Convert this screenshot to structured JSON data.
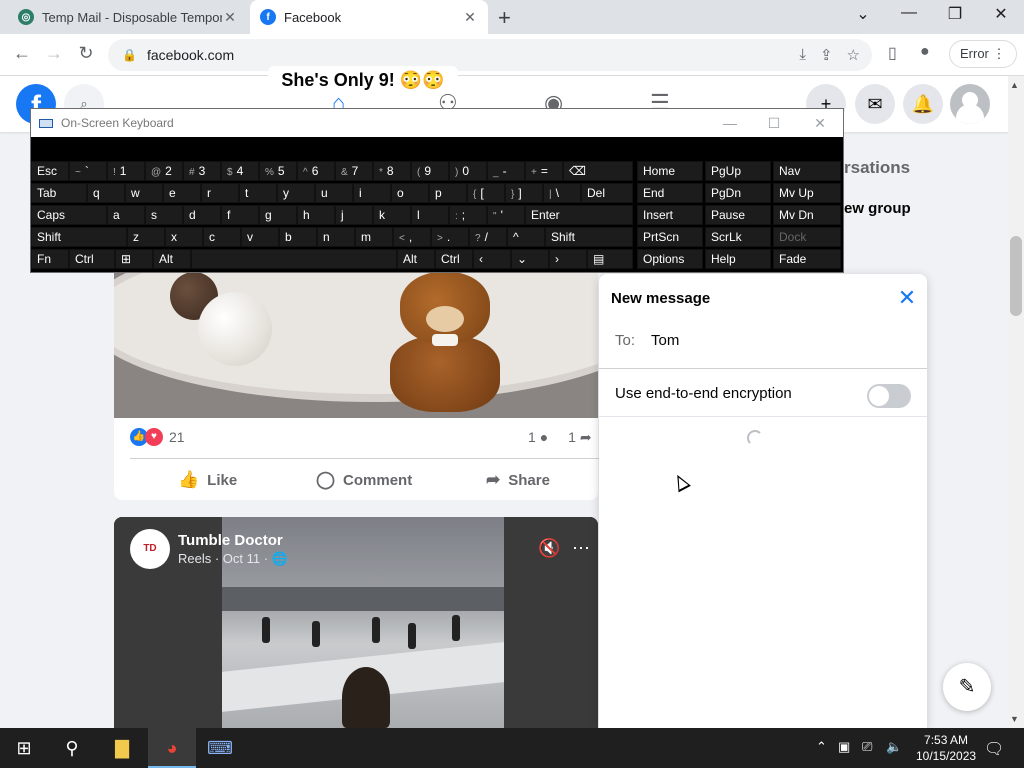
{
  "browser": {
    "tabs": [
      {
        "title": "Temp Mail - Disposable Tempora",
        "favicon": "temp-mail-icon"
      },
      {
        "title": "Facebook",
        "favicon": "facebook-icon"
      }
    ],
    "url": "facebook.com",
    "profile_button": "Error"
  },
  "background_right": {
    "conversations_fragment": "rsations",
    "new_group_fragment": "ew group"
  },
  "post1": {
    "reaction_count": "21",
    "comments_count": "1",
    "shares_count": "1",
    "like_label": "Like",
    "comment_label": "Comment",
    "share_label": "Share"
  },
  "post2": {
    "author": "Tumble Doctor",
    "meta": "Reels · Oct 11 ·",
    "caption": "She's Only 9! 😳😳"
  },
  "new_message": {
    "title": "New message",
    "to_label": "To:",
    "to_value": "Tom",
    "e2e_label": "Use end-to-end encryption",
    "e2e_enabled": false
  },
  "osk": {
    "title": "On-Screen Keyboard"
  },
  "taskbar": {
    "time": "7:53 AM",
    "date": "10/15/2023"
  },
  "colors": {
    "facebook_blue": "#1877f2",
    "taskbar": "#1f1f1f"
  }
}
